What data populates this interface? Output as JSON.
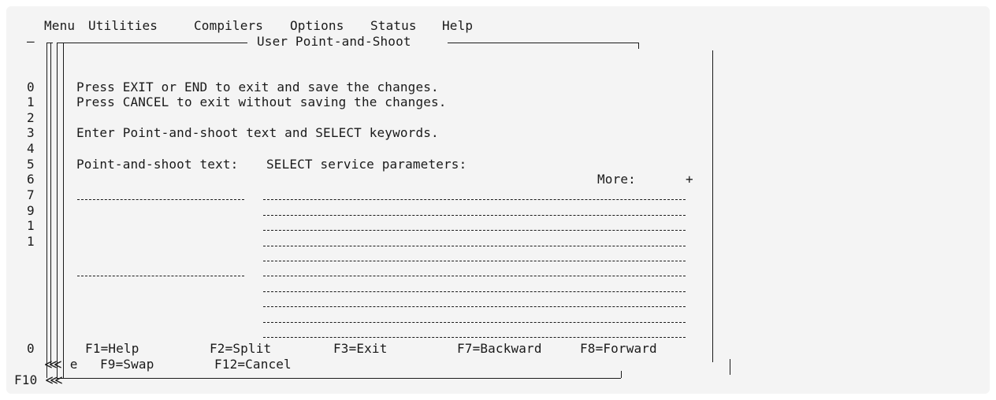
{
  "menubar": {
    "items": [
      "Menu",
      "Utilities",
      "Compilers",
      "Options",
      "Status",
      "Help"
    ]
  },
  "dialog": {
    "title": "User Point-and-Shoot",
    "instructions": [
      "Press EXIT or END to exit and save the changes.",
      "Press CANCEL to exit without saving the changes.",
      "Enter Point-and-shoot text and SELECT keywords."
    ],
    "col_label_text": "Point-and-shoot text:",
    "col_label_select": "SELECT service parameters:",
    "more_label": "More:",
    "more_indicator": "+",
    "function_keys_row1": [
      "F1=Help",
      "F2=Split",
      "F3=Exit",
      "F7=Backward",
      "F8=Forward"
    ],
    "function_keys_row2": [
      "F9=Swap",
      "F12=Cancel"
    ]
  },
  "background": {
    "line_numbers": [
      "0",
      "1",
      "2",
      "3",
      "4",
      "5",
      "6",
      "7",
      "9",
      "1",
      "1"
    ],
    "bottom_line_number": "0",
    "bottom_left_marker": "⋘ e",
    "bottom_left_key": "F10 ⋘",
    "top_left_dash": "–"
  }
}
